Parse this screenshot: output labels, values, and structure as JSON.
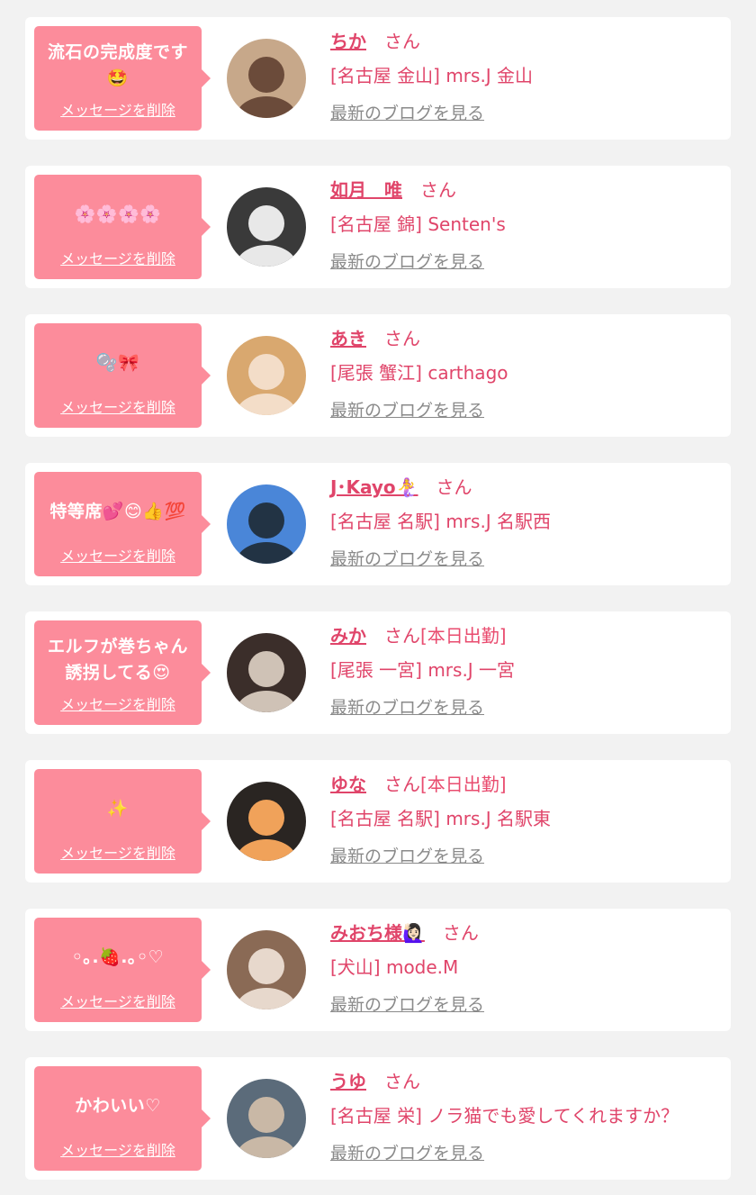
{
  "items": [
    {
      "message": "流石の完成度です\n🤩",
      "delete_label": "メッセージを削除",
      "name": "ちか",
      "honorific": "さん",
      "status": "",
      "shop": "[名古屋 金山] mrs.J 金山",
      "blog_label": "最新のブログを見る",
      "avatar_colors": [
        "#c7a88a",
        "#6b4b3a"
      ]
    },
    {
      "message": "🌸🌸🌸🌸",
      "delete_label": "メッセージを削除",
      "name": "如月　唯",
      "honorific": "さん",
      "status": "",
      "shop": "[名古屋 錦] Senten's",
      "blog_label": "最新のブログを見る",
      "avatar_colors": [
        "#3a3a3a",
        "#e8e8e8"
      ]
    },
    {
      "message": "🫧🎀",
      "delete_label": "メッセージを削除",
      "name": "あき",
      "honorific": "さん",
      "status": "",
      "shop": "[尾張 蟹江] carthago",
      "blog_label": "最新のブログを見る",
      "avatar_colors": [
        "#d9a86f",
        "#f3ddc8"
      ]
    },
    {
      "message": "特等席💕😊👍💯",
      "delete_label": "メッセージを削除",
      "name": "J･Kayo🧜‍♀️",
      "honorific": "さん",
      "status": "",
      "shop": "[名古屋 名駅] mrs.J 名駅西",
      "blog_label": "最新のブログを見る",
      "avatar_colors": [
        "#4a86d8",
        "#223344"
      ]
    },
    {
      "message": "エルフが巻ちゃん\n誘拐してる😍",
      "delete_label": "メッセージを削除",
      "name": "みか",
      "honorific": "さん",
      "status": "[本日出勤]",
      "shop": "[尾張 一宮] mrs.J 一宮",
      "blog_label": "最新のブログを見る",
      "avatar_colors": [
        "#3b2e2a",
        "#cfc2b6"
      ]
    },
    {
      "message": "✨",
      "delete_label": "メッセージを削除",
      "name": "ゆな",
      "honorific": "さん",
      "status": "[本日出勤]",
      "shop": "[名古屋 名駅] mrs.J 名駅東",
      "blog_label": "最新のブログを見る",
      "avatar_colors": [
        "#2a2522",
        "#f0a25a"
      ]
    },
    {
      "message": "◦｡.🍓.｡◦♡",
      "delete_label": "メッセージを削除",
      "name": "みおち様🙋🏻‍♀️",
      "honorific": "さん",
      "status": "",
      "shop": "[犬山] mode.M",
      "blog_label": "最新のブログを見る",
      "avatar_colors": [
        "#8a6a55",
        "#e7d8cc"
      ]
    },
    {
      "message": "かわいい♡",
      "delete_label": "メッセージを削除",
      "name": "うゆ",
      "honorific": "さん",
      "status": "",
      "shop": "[名古屋 栄] ノラ猫でも愛してくれますか？",
      "blog_label": "最新のブログを見る",
      "avatar_colors": [
        "#5b6b7a",
        "#c9b8a6"
      ]
    }
  ]
}
